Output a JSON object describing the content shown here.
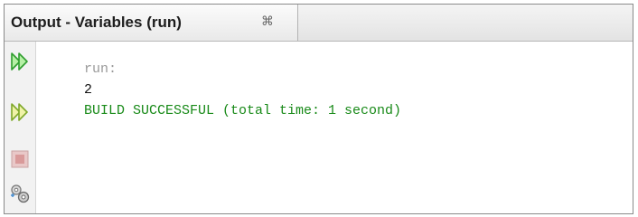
{
  "tab": {
    "title": "Output - Variables (run)",
    "close_glyph": "⌘"
  },
  "toolbar": {
    "buttons": [
      {
        "icon": "rerun-icon",
        "label": "Re-run"
      },
      {
        "icon": "rerun-with-options-icon",
        "label": "Re-run with options"
      },
      {
        "icon": "stop-icon",
        "label": "Stop"
      },
      {
        "icon": "settings-icon",
        "label": "Settings"
      }
    ]
  },
  "output": {
    "lines": [
      "run:",
      "2",
      "BUILD SUCCESSFUL (total time: 1 second)"
    ]
  },
  "colors": {
    "run_text": "#9a9a9a",
    "value_text": "#111111",
    "success_text": "#188a18",
    "rerun_green": "#3cc23c",
    "stop_red": "#d99a9a"
  }
}
